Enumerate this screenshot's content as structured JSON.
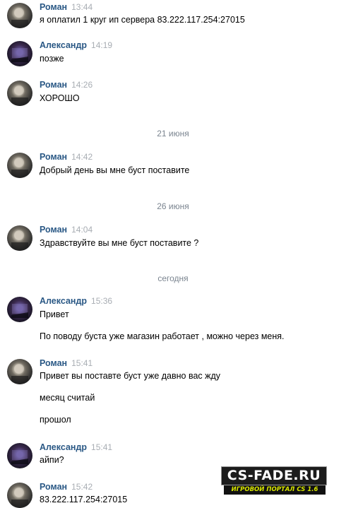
{
  "messages": [
    {
      "author": "Роман",
      "time": "13:44",
      "lines": [
        "я оплатил 1 круг ип сервера 83.222.117.254:27015"
      ]
    },
    {
      "author": "Александр",
      "time": "14:19",
      "lines": [
        "позже"
      ]
    },
    {
      "author": "Роман",
      "time": "14:26",
      "lines": [
        "ХОРОШО"
      ]
    },
    {
      "author": "Роман",
      "time": "14:42",
      "lines": [
        "Добрый день вы мне буст поставите"
      ]
    },
    {
      "author": "Роман",
      "time": "14:04",
      "lines": [
        "Здравствуйте вы мне буст поставите ?"
      ]
    },
    {
      "author": "Александр",
      "time": "15:36",
      "lines": [
        "Привет",
        "По поводу буста уже магазин работает , можно через меня."
      ]
    },
    {
      "author": "Роман",
      "time": "15:41",
      "lines": [
        "Привет вы поставте буст уже давно вас жду",
        "месяц считай",
        "прошол"
      ]
    },
    {
      "author": "Александр",
      "time": "15:41",
      "lines": [
        "айпи?"
      ]
    },
    {
      "author": "Роман",
      "time": "15:42",
      "lines": [
        "83.222.117.254:27015"
      ]
    }
  ],
  "date_separators": [
    "21 июня",
    "26 июня",
    "сегодня"
  ],
  "watermark": {
    "title": "CS-FADE.RU",
    "subtitle": "ИГРОВОЙ ПОРТАЛ CS 1.6"
  },
  "colors": {
    "author_name": "#2a5885",
    "time": "#a8adb3",
    "date_separator": "#7b8590",
    "watermark_subtitle": "#d8e600"
  }
}
